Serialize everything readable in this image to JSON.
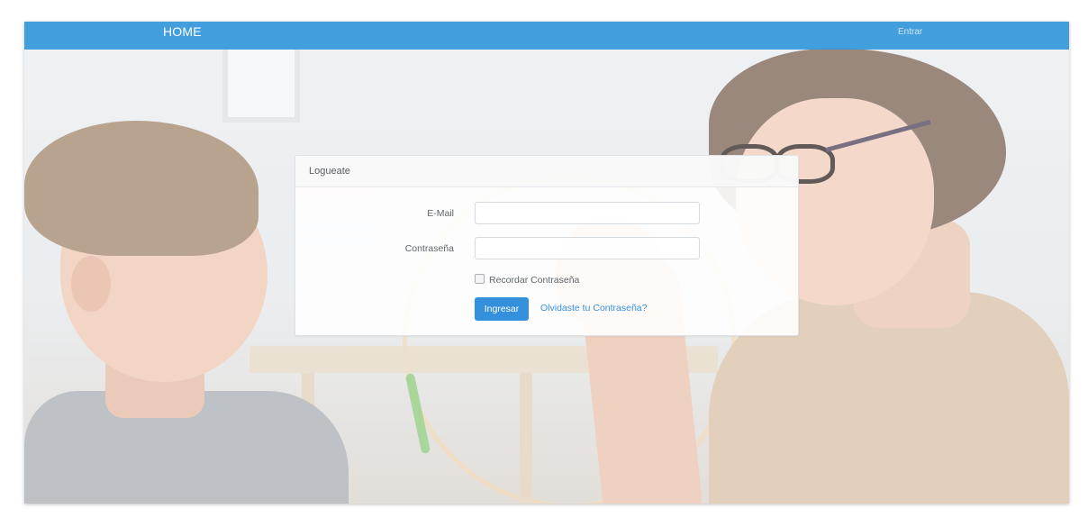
{
  "navbar": {
    "brand": "HOME",
    "login_link": "Entrar",
    "color": "#3498db"
  },
  "login_panel": {
    "heading": "Logueate",
    "email_label": "E-Mail",
    "email_value": "",
    "password_label": "Contraseña",
    "password_value": "",
    "remember_label": "Recordar Contraseña",
    "remember_checked": false,
    "submit_label": "Ingresar",
    "forgot_link": "Olvidaste tu Contraseña?",
    "accent_color": "#3490dc"
  },
  "background": {
    "description_icon": "photo-background"
  }
}
